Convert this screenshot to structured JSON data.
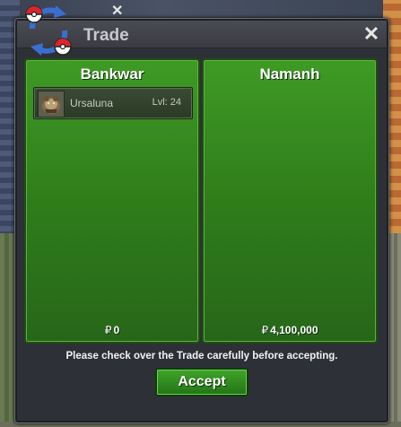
{
  "window": {
    "title": "Trade",
    "close_icon": "close-icon"
  },
  "left_panel": {
    "player_name": "Bankwar",
    "items": [
      {
        "name": "Ursaluna",
        "level": "Lvl: 24",
        "icon": "ursaluna-sprite-icon"
      }
    ],
    "currency_symbol": "₽",
    "money": "0"
  },
  "right_panel": {
    "player_name": "Namanh",
    "items": [],
    "currency_symbol": "₽",
    "money": "4,100,000"
  },
  "notice": "Please check over the Trade carefully before accepting.",
  "accept_label": "Accept",
  "colors": {
    "panel_green": "#2f7d1a",
    "button_green": "#2f8a1f",
    "window_bg": "#2e3037"
  }
}
